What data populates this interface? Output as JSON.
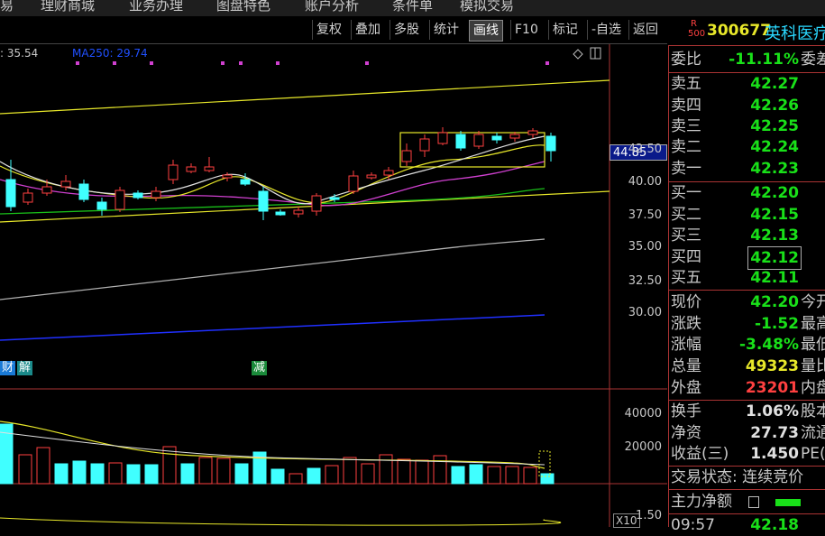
{
  "menu": [
    "易",
    "理财商城",
    "业务办理",
    "图盘特色",
    "账户分析",
    "条件单",
    "模拟交易"
  ],
  "toolbar": {
    "items": [
      "复权",
      "叠加",
      "多股",
      "统计",
      "画线",
      "F10",
      "标记",
      "-自选",
      "返回"
    ],
    "active": "画线"
  },
  "stock": {
    "r_top": "R",
    "r_bottom": "500",
    "code": "300677",
    "name": "英科医疗"
  },
  "ma_legend": [
    {
      "text": ": 35.54",
      "color": "#c8c8c8"
    },
    {
      "text": "MA250: 29.74",
      "color": "#2050ff"
    }
  ],
  "price_axis": [
    "42.50",
    "40.00",
    "37.50",
    "35.00",
    "32.50",
    "30.00"
  ],
  "current_price_tag": "44.85",
  "volume_axis": [
    "40000",
    "20000"
  ],
  "volume_multiplier": "X10",
  "bottom_axis": "1.50",
  "event_badges": [
    {
      "text": "财",
      "color": "#1a7ad6"
    },
    {
      "text": "解",
      "color": "#1a8a8a"
    },
    {
      "text": "减",
      "color": "#1a8a3a"
    }
  ],
  "panel": {
    "weibi": {
      "label": "委比",
      "value": "-11.11%",
      "right_label": "委差"
    },
    "asks": [
      {
        "label": "卖五",
        "price": "42.27"
      },
      {
        "label": "卖四",
        "price": "42.26"
      },
      {
        "label": "卖三",
        "price": "42.25"
      },
      {
        "label": "卖二",
        "price": "42.24"
      },
      {
        "label": "卖一",
        "price": "42.23"
      }
    ],
    "bids": [
      {
        "label": "买一",
        "price": "42.20"
      },
      {
        "label": "买二",
        "price": "42.15"
      },
      {
        "label": "买三",
        "price": "42.13"
      },
      {
        "label": "买四",
        "price": "42.12"
      },
      {
        "label": "买五",
        "price": "42.11"
      }
    ],
    "quote": [
      {
        "label": "现价",
        "value": "42.20",
        "color": "#19e019",
        "right_label": "今开"
      },
      {
        "label": "涨跌",
        "value": "-1.52",
        "color": "#19e019",
        "right_label": "最高"
      },
      {
        "label": "涨幅",
        "value": "-3.48%",
        "color": "#19e019",
        "right_label": "最低"
      },
      {
        "label": "总量",
        "value": "49323",
        "color": "#e8e82a",
        "right_label": "量比"
      },
      {
        "label": "外盘",
        "value": "23201",
        "color": "#ff4040",
        "right_label": "内盘"
      }
    ],
    "fundamentals": [
      {
        "label": "换手",
        "value": "1.06%",
        "right_label": "股本"
      },
      {
        "label": "净资",
        "value": "27.73",
        "right_label": "流通"
      },
      {
        "label": "收益(三)",
        "value": "1.450",
        "right_label": "PE(动"
      }
    ],
    "trade_status": "交易状态: 连续竞价",
    "main_flow_label": "主力净额",
    "last_tick_time": "09:57",
    "last_tick_price": "42.18"
  },
  "colors": {
    "up": "#ff4040",
    "down": "#40ffff",
    "green": "#19e019",
    "yellow": "#e8e82a",
    "panel_border": "#aa3333"
  }
}
